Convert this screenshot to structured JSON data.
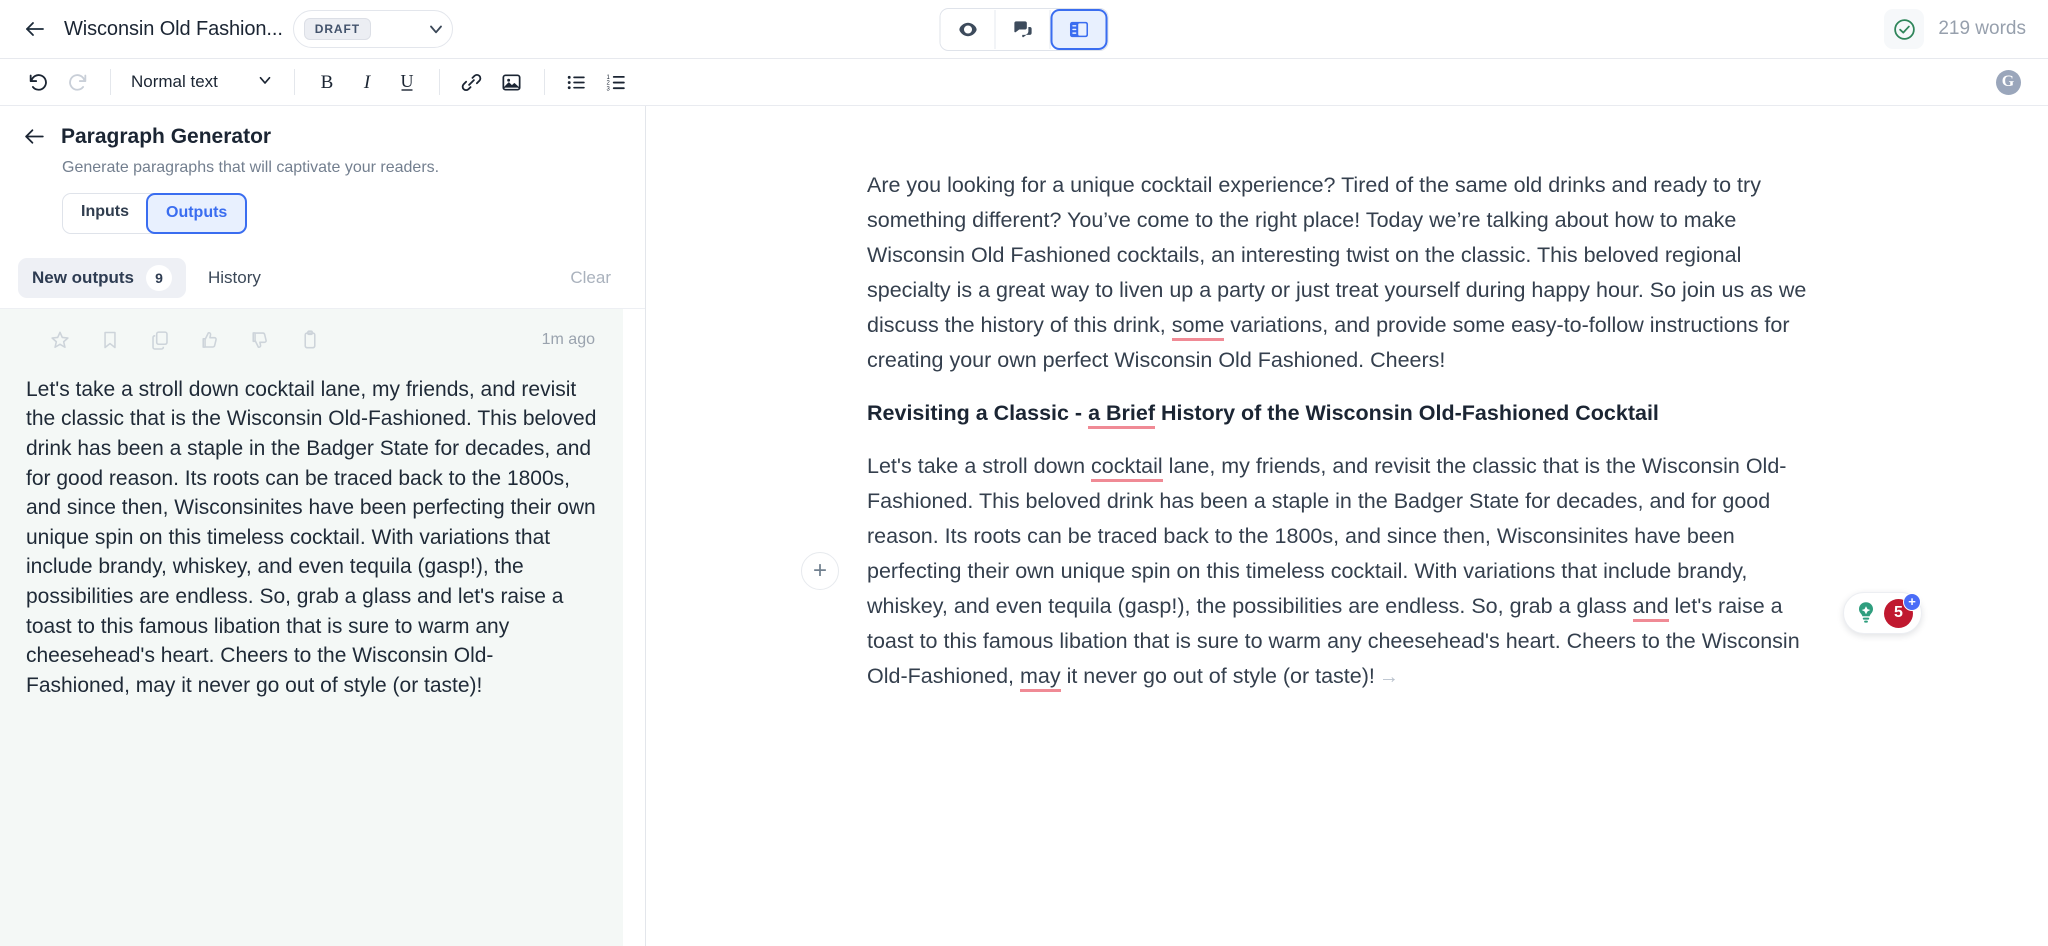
{
  "header": {
    "back_icon": "arrow-left-icon",
    "doc_title": "Wisconsin Old Fashion...",
    "status_badge": "DRAFT",
    "dropdown_icon": "chevron-down-icon",
    "center_buttons": [
      {
        "name": "preview",
        "icon": "eye-icon",
        "active": false
      },
      {
        "name": "comments",
        "icon": "chat-bubbles-icon",
        "active": false
      },
      {
        "name": "side-panel",
        "icon": "sidebar-panel-icon",
        "active": true
      }
    ],
    "status_check_icon": "check-circle-icon",
    "word_count": "219 words"
  },
  "toolbar": {
    "undo_icon": "undo-icon",
    "redo_icon": "redo-icon",
    "style_label": "Normal text",
    "style_chevron": "chevron-down-icon",
    "bold_label": "B",
    "italic_label": "I",
    "underline_label": "U",
    "link_icon": "link-icon",
    "image_icon": "image-icon",
    "bullet_list_icon": "bullet-list-icon",
    "numbered_list_icon": "numbered-list-icon",
    "grammarly_label": "G"
  },
  "sidebar": {
    "back_icon": "arrow-left-icon",
    "tool_title": "Paragraph Generator",
    "tool_subtitle": "Generate paragraphs that will captivate your readers.",
    "io_tabs": [
      {
        "label": "Inputs",
        "active": false
      },
      {
        "label": "Outputs",
        "active": true
      }
    ],
    "new_outputs_label": "New outputs",
    "new_outputs_count": "9",
    "history_label": "History",
    "clear_label": "Clear",
    "card": {
      "actions": [
        "star-icon",
        "bookmark-icon",
        "copy-icon",
        "thumbs-up-icon",
        "thumbs-down-icon",
        "clipboard-icon"
      ],
      "timestamp": "1m ago",
      "text": "Let's take a stroll down cocktail lane, my friends, and revisit the classic that is the Wisconsin Old-Fashioned. This beloved drink has been a staple in the Badger State for decades, and for good reason. Its roots can be traced back to the 1800s, and since then, Wisconsinites have been perfecting their own unique spin on this timeless cocktail. With variations that include brandy, whiskey, and even tequila (gasp!), the possibilities are endless. So, grab a glass and let's raise a toast to this famous libation that is sure to warm any cheesehead's heart. Cheers to the Wisconsin Old-Fashioned, may it never go out of style (or taste)!"
    }
  },
  "document": {
    "paragraph1_a": "Are you looking for a unique cocktail experience? Tired of the same old drinks and ready to try something different? You’ve come to the right place! Today we’re talking about how to make Wisconsin Old Fashioned cocktails, an interesting twist on the classic. This beloved regional specialty is a great way to liven up a party or just treat yourself during happy hour. So join us as we discuss the history of this drink, ",
    "paragraph1_mark": "some",
    "paragraph1_b": " variations, and provide some easy-to-follow instructions for creating your own perfect Wisconsin Old Fashioned. Cheers!",
    "heading_a": "Revisiting a Classic - ",
    "heading_mark": "a Brief",
    "heading_b": " History of the Wisconsin Old-Fashioned Cocktail",
    "paragraph2_a": "Let's take a stroll down ",
    "paragraph2_mark1": "cocktail",
    "paragraph2_b": " lane, my friends, and revisit the classic that is the Wisconsin Old-Fashioned. This beloved drink has been a staple in the Badger State for decades, and for good reason. Its roots can be traced back to the 1800s, and since then, Wisconsinites have been perfecting their own unique spin on this timeless cocktail. With variations that include brandy, whiskey, and even tequila (gasp!), the possibilities are endless. So, grab a glass ",
    "paragraph2_mark2": "and",
    "paragraph2_c": " let's raise a toast to this famous libation that is sure to warm any cheesehead's heart. Cheers to the Wisconsin Old-Fashioned, ",
    "paragraph2_mark3": "may",
    "paragraph2_d": " it never go out of style (or taste)!",
    "end_arrow": "→",
    "add_block_label": "+"
  },
  "grammarly_widget": {
    "bulb_icon": "lightbulb-icon",
    "issue_count": "5",
    "plus_label": "+"
  },
  "colors": {
    "accent_blue": "#3a6df0",
    "grammar_red": "#f08a95",
    "badge_red": "#c0182f",
    "card_bg": "#f4f8f6"
  }
}
